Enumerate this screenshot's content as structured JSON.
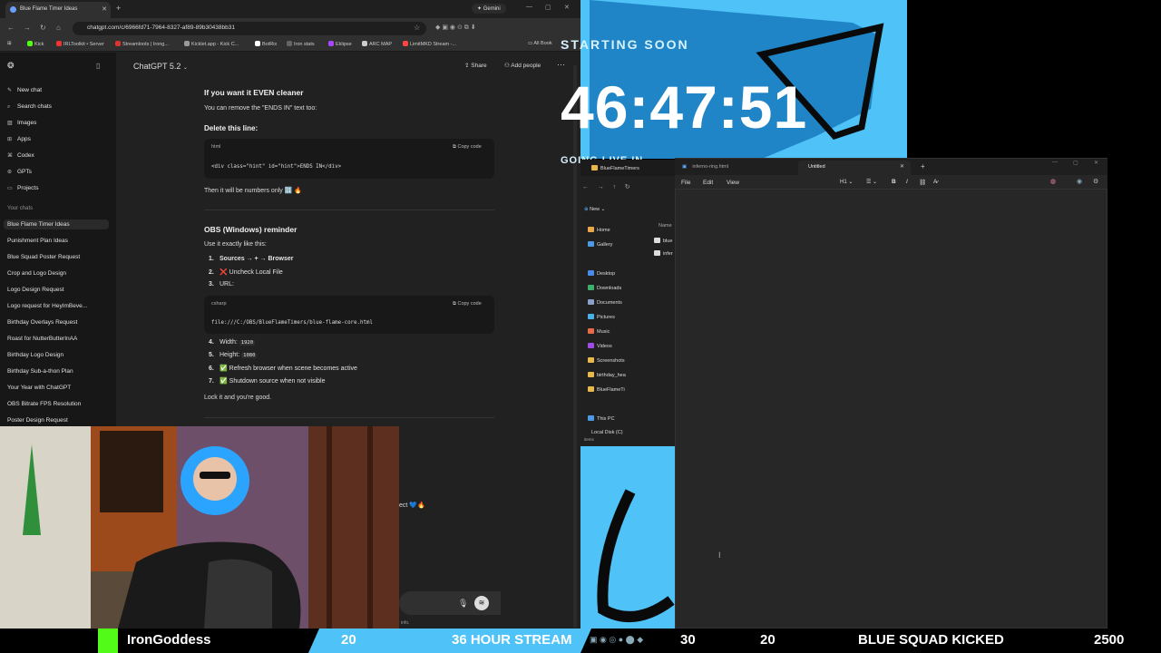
{
  "browser": {
    "tab_title": "Blue Flame Timer Ideas",
    "gemini_label": "Gemini",
    "url": "chatgpt.com/c/6966fd71-7964-8327-af89-89b30438bb31",
    "bookmarks": [
      "Kick",
      "IRLToolkit • Server",
      "Streamloots | Irong...",
      "Kicklet.app - Kick C...",
      "BotRix",
      "Iron stats",
      "Eklipse",
      "ARC MAP",
      "LimitMKD Stream -..."
    ],
    "all_bookmarks": "All Book"
  },
  "chatgpt": {
    "model": "ChatGPT 5.2",
    "share": "Share",
    "add_people": "Add people",
    "nav": [
      "New chat",
      "Search chats",
      "Images",
      "Apps",
      "Codex",
      "GPTs",
      "Projects"
    ],
    "section": "Your chats",
    "chats": [
      "Blue Flame Timer Ideas",
      "Punishment Plan Ideas",
      "Blue Squad Poster Request",
      "Crop and Logo Design",
      "Logo Design Request",
      "Logo request for HeyImBeve...",
      "Birthday Overlays Request",
      "Roast for NutterButterInAA",
      "Birthday Logo Design",
      "Birthday Sub-a-thon Plan",
      "Your Year with ChatGPT",
      "OBS Bitrate FPS Resolution",
      "Poster Design Request"
    ],
    "content": {
      "h1": "If you want it EVEN cleaner",
      "p1": "You can remove the \"ENDS IN\" text too:",
      "h2": "Delete this line:",
      "code1_lang": "html",
      "copy_code": "Copy code",
      "code1": "<div class=\"hint\" id=\"hint\">ENDS IN</div>",
      "p2": "Then it will be numbers only 🔢 🔥",
      "h3": "OBS (Windows) reminder",
      "p3": "Use it exactly like this:",
      "steps": [
        "Sources → + → Browser",
        "❌ Uncheck Local File",
        "URL:"
      ],
      "code2_lang": "csharp",
      "code2": "file:///C:/OBS/BlueFlameTimers/blue-flame-core.html",
      "steps2": [
        {
          "n": "4.",
          "label": "Width:",
          "val": "1920"
        },
        {
          "n": "5.",
          "label": "Height:",
          "val": "1080"
        },
        {
          "n": "6.",
          "label": "✅ Refresh browser when scene becomes active",
          "val": ""
        },
        {
          "n": "7.",
          "label": "✅ Shutdown source when not visible",
          "val": ""
        }
      ],
      "p4": "Lock it and you're good.",
      "tail": "ect 💙🔥",
      "footnote": "info."
    }
  },
  "overlay": {
    "starting_soon": "STARTING SOON",
    "countdown": "46:47:51",
    "going_live": "GOING LIVE IN"
  },
  "explorer": {
    "title": "BlueFlameTimers",
    "new": "New",
    "col_name": "Name",
    "files": [
      "blue",
      "infer"
    ],
    "nav": [
      "Home",
      "Gallery",
      "Desktop",
      "Downloads",
      "Documents",
      "Pictures",
      "Music",
      "Videos",
      "Screenshots",
      "birthday_hea",
      "BlueFlameTi",
      "This PC",
      "Local Disk (C)"
    ],
    "status": "items"
  },
  "notepad": {
    "tab1": "inferno-ring.html",
    "tab2": "Untitled",
    "menu": [
      "File",
      "Edit",
      "View"
    ],
    "heading": "H1"
  },
  "ticker": {
    "name": "IronGoddess",
    "v1": "20",
    "stream": "36 HOUR STREAM",
    "v2": "30",
    "v3": "20",
    "kicked": "BLUE SQUAD KICKED",
    "v4": "2500"
  },
  "colors": {
    "accent": "#4fc3f7",
    "kick_green": "#53fc18"
  }
}
